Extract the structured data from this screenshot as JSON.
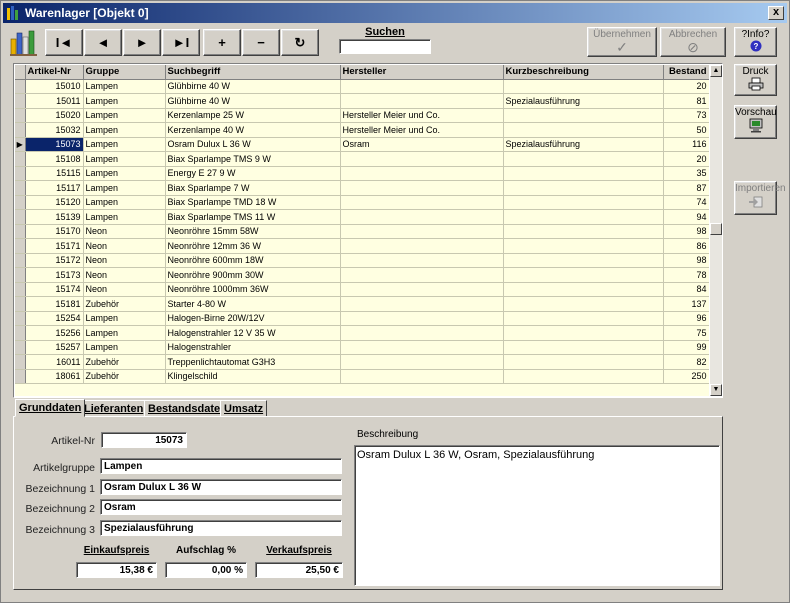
{
  "window": {
    "title": "Warenlager [Objekt 0]",
    "close_label": "x"
  },
  "toolbar": {
    "first": "I◄",
    "prev": "◄",
    "next": "►",
    "last": "►I",
    "add": "+",
    "remove": "−",
    "refresh": "↻",
    "search_label": "Suchen",
    "search_value": "",
    "apply_label": "Übernehmen",
    "cancel_label": "Abbrechen",
    "info_label": "?Info?"
  },
  "side": {
    "print_label": "Druck",
    "preview_label": "Vorschau",
    "import_label": "Importieren"
  },
  "grid": {
    "columns": [
      "Artikel-Nr",
      "Gruppe",
      "Suchbegriff",
      "Hersteller",
      "Kurzbeschreibung",
      "Bestand"
    ],
    "current_row_index": 4,
    "rows": [
      [
        "15010",
        "Lampen",
        "Glühbirne 40 W",
        "",
        "",
        "20"
      ],
      [
        "15011",
        "Lampen",
        "Glühbirne 40 W",
        "",
        "Spezialausführung",
        "81"
      ],
      [
        "15020",
        "Lampen",
        "Kerzenlampe 25 W",
        "Hersteller Meier und Co.",
        "",
        "73"
      ],
      [
        "15032",
        "Lampen",
        "Kerzenlampe 40 W",
        "Hersteller Meier und Co.",
        "",
        "50"
      ],
      [
        "15073",
        "Lampen",
        "Osram Dulux L 36 W",
        "Osram",
        "Spezialausführung",
        "116"
      ],
      [
        "15108",
        "Lampen",
        "Biax Sparlampe TMS 9 W",
        "",
        "",
        "20"
      ],
      [
        "15115",
        "Lampen",
        "Energy E 27 9 W",
        "",
        "",
        "35"
      ],
      [
        "15117",
        "Lampen",
        "Biax Sparlampe 7 W",
        "",
        "",
        "87"
      ],
      [
        "15120",
        "Lampen",
        "Biax Sparlampe TMD 18 W",
        "",
        "",
        "74"
      ],
      [
        "15139",
        "Lampen",
        "Biax Sparlampe TMS 11 W",
        "",
        "",
        "94"
      ],
      [
        "15170",
        "Neon",
        "Neonröhre 15mm 58W",
        "",
        "",
        "98"
      ],
      [
        "15171",
        "Neon",
        "Neonröhre 12mm 36 W",
        "",
        "",
        "86"
      ],
      [
        "15172",
        "Neon",
        "Neonröhre 600mm 18W",
        "",
        "",
        "98"
      ],
      [
        "15173",
        "Neon",
        "Neonröhre 900mm 30W",
        "",
        "",
        "78"
      ],
      [
        "15174",
        "Neon",
        "Neonröhre 1000mm 36W",
        "",
        "",
        "84"
      ],
      [
        "15181",
        "Zubehör",
        "Starter 4-80 W",
        "",
        "",
        "137"
      ],
      [
        "15254",
        "Lampen",
        "Halogen-Birne 20W/12V",
        "",
        "",
        "96"
      ],
      [
        "15256",
        "Lampen",
        "Halogenstrahler 12 V 35 W",
        "",
        "",
        "75"
      ],
      [
        "15257",
        "Lampen",
        "Halogenstrahler",
        "",
        "",
        "99"
      ],
      [
        "16011",
        "Zubehör",
        "Treppenlichtautomat G3H3",
        "",
        "",
        "82"
      ],
      [
        "18061",
        "Zubehör",
        "Klingelschild",
        "",
        "",
        "250"
      ]
    ]
  },
  "tabs": [
    "Grunddaten",
    "Lieferanten",
    "Bestandsdaten",
    "Umsatz"
  ],
  "form": {
    "artikel_nr_label": "Artikel-Nr",
    "artikel_nr": "15073",
    "artikelgruppe_label": "Artikelgruppe",
    "artikelgruppe": "Lampen",
    "bez1_label": "Bezeichnung 1",
    "bez1": "Osram Dulux L 36 W",
    "bez2_label": "Bezeichnung 2",
    "bez2": "Osram",
    "bez3_label": "Bezeichnung 3",
    "bez3": "Spezialausführung",
    "einkauf_label": "Einkaufspreis",
    "einkauf": "15,38 €",
    "aufschlag_label": "Aufschlag %",
    "aufschlag": "0,00 %",
    "verkauf_label": "Verkaufspreis",
    "verkauf": "25,50 €",
    "beschreibung_label": "Beschreibung",
    "beschreibung": "Osram Dulux L 36 W, Osram, Spezialausführung"
  }
}
